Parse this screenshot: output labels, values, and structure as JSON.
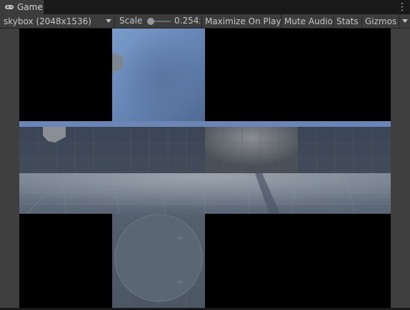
{
  "tab": {
    "title": "Game",
    "icon": "gamepad-icon"
  },
  "toolbar": {
    "display_dropdown": "skybox (2048x1536)",
    "scale_label": "Scale",
    "scale_value": "0.254x",
    "maximize_on_play": "Maximize On Play",
    "mute_audio": "Mute Audio",
    "stats": "Stats",
    "gizmos": "Gizmos"
  },
  "colors": {
    "background_dark": "#191919",
    "toolbar": "#3c3c3c",
    "text": "#c4c4c4",
    "sky_blue": "#6b8ab8",
    "floor": "#5d6878"
  }
}
